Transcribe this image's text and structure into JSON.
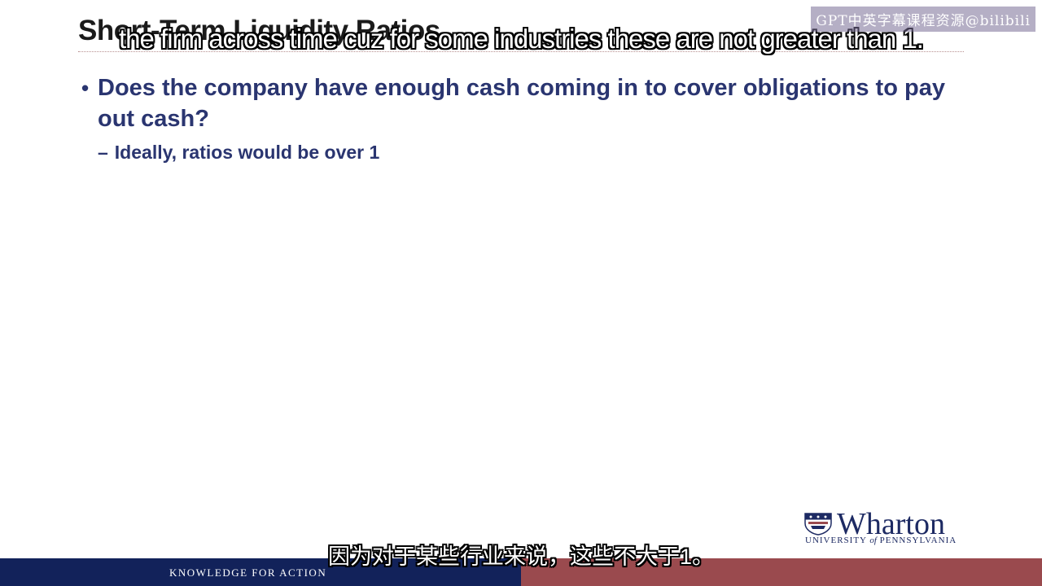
{
  "slide": {
    "title": "Short-Term Liquidity Ratios",
    "bullet1": "Does the company have enough cash coming in to cover obligations to pay out cash?",
    "bullet1_marker": "•",
    "bullet2": "Ideally, ratios would be over 1",
    "bullet2_marker": "–"
  },
  "subtitles": {
    "english": "the firm across time cuz for some industries these are not greater than 1.",
    "chinese": "因为对于某些行业来说，这些不大于1。"
  },
  "watermark": "GPT中英字幕课程资源@bilibili",
  "logo": {
    "name": "Wharton",
    "university_prefix": "UNIVERSITY ",
    "university_of": "of",
    "university_suffix": " PENNSYLVANIA"
  },
  "footer": {
    "tagline": "KNOWLEDGE FOR ACTION"
  },
  "colors": {
    "navy": "#12225a",
    "maroon": "#9a4a4e",
    "bullet_text": "#2a3570"
  }
}
